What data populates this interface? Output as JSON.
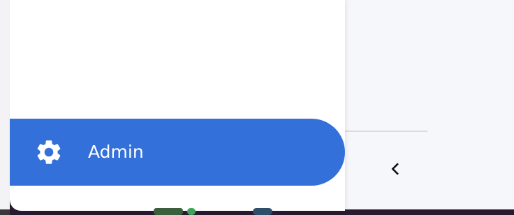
{
  "navigation": {
    "active_item": {
      "label": "Admin",
      "icon": "gear-icon",
      "color": "#3470d9"
    }
  },
  "panel": {
    "back_button_icon": "chevron-left-icon"
  }
}
